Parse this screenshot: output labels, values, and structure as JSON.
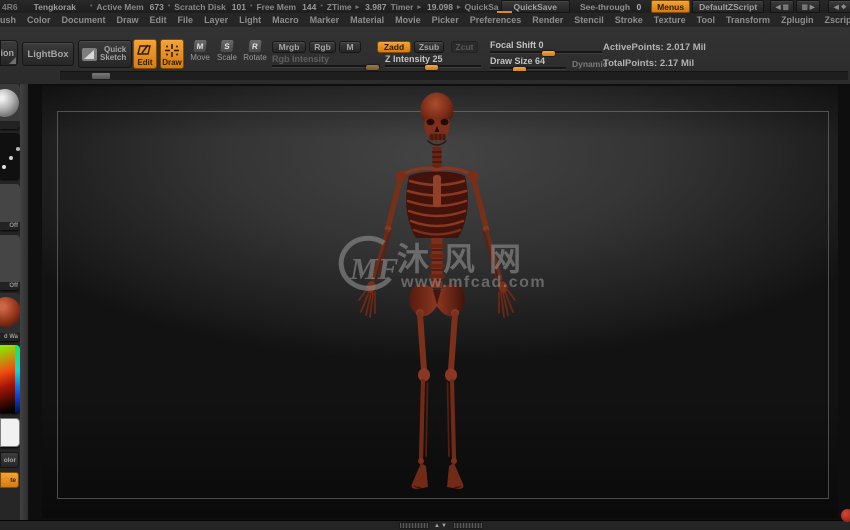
{
  "title_bar": {
    "version": "4R6",
    "document_title": "Tengkorak",
    "metrics": [
      {
        "label": "Active Mem",
        "value": "673"
      },
      {
        "label": "Scratch Disk",
        "value": "101"
      },
      {
        "label": "Free Mem",
        "value": "144"
      },
      {
        "label": "ZTime",
        "value": "3.987"
      },
      {
        "label": "Timer",
        "value": "19.098"
      }
    ],
    "quick_fragment": "QuickSa",
    "quicksave_label": "QuickSave",
    "see_through_label": "See-through",
    "see_through_value": "0",
    "menus_label": "Menus",
    "default_zscript_label": "DefaultZScript"
  },
  "menu_bar": {
    "items": [
      "ush",
      "Color",
      "Document",
      "Draw",
      "Edit",
      "File",
      "Layer",
      "Light",
      "Macro",
      "Marker",
      "Material",
      "Movie",
      "Picker",
      "Preferences",
      "Render",
      "Stencil",
      "Stroke",
      "Texture",
      "Tool",
      "Transform",
      "Zplugin",
      "Zscript"
    ]
  },
  "toolbar": {
    "projection_fragment": "ion",
    "lightbox_label": "LightBox",
    "quick_sketch_line1": "Quick",
    "quick_sketch_line2": "Sketch",
    "edit_label": "Edit",
    "draw_label": "Draw",
    "move_label": "Move",
    "scale_label": "Scale",
    "rotate_label": "Rotate",
    "move_letter": "M",
    "scale_letter": "S",
    "rotate_letter": "R",
    "mrgb_label": "Mrgb",
    "rgb_label": "Rgb",
    "m_label": "M",
    "zadd_label": "Zadd",
    "zsub_label": "Zsub",
    "zcut_label": "Zcut",
    "rgb_intensity_label": "Rgb Intensity",
    "z_intensity_label": "Z Intensity 25",
    "focal_shift_label": "Focal Shift 0",
    "draw_size_label": "Draw Size 64",
    "dynamic_label": "Dynamic",
    "active_points": "ActivePoints: 2.017 Mil",
    "total_points": "TotalPoints: 2.17 Mil"
  },
  "left_tray": {
    "alpha_status": "Off",
    "texture_status": "Off",
    "material_fragment": "d Wa",
    "switch_color_fragment": "olor",
    "paste_fragment": "te"
  },
  "canvas": {
    "watermark": {
      "logo": "MF",
      "title": "沐风网",
      "url": "www.mfcad.com"
    }
  },
  "bottom_bar": {
    "up": "▲",
    "down": "▼"
  },
  "icons": {
    "bullet": "•",
    "arrow": "▸",
    "left": "◀",
    "right": "▶",
    "pages": "▥",
    "hand": "❖",
    "menu": "≡"
  },
  "colors": {
    "accent_orange": "#e08a1d",
    "skeleton_base": "#702716",
    "skeleton_light": "#9c4326",
    "skeleton_dark": "#3a1008",
    "canvas_top": "#444444",
    "canvas_bottom": "#141414",
    "watermark_gray": "#9b9b9b"
  }
}
